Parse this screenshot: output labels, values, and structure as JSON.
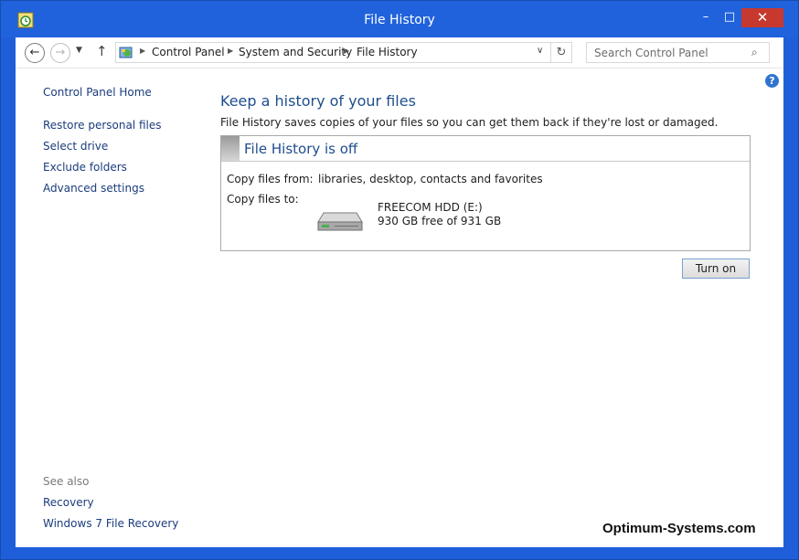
{
  "window": {
    "title": "File History"
  },
  "window_controls": {
    "minimize": "–",
    "maximize": "□",
    "close": "✕"
  },
  "navigation": {
    "back": "←",
    "forward": "→",
    "recent": "▼",
    "up": "↑",
    "breadcrumbs": [
      "Control Panel",
      "System and Security",
      "File History"
    ],
    "refresh": "↻",
    "search_placeholder": "Search Control Panel",
    "search_glyph": "⌕"
  },
  "help": "?",
  "sidebar": {
    "home": "Control Panel Home",
    "items": [
      "Restore personal files",
      "Select drive",
      "Exclude folders",
      "Advanced settings"
    ],
    "see_also_label": "See also",
    "see_also": [
      "Recovery",
      "Windows 7 File Recovery"
    ]
  },
  "main": {
    "heading": "Keep a history of your files",
    "description": "File History saves copies of your files so you can get them back if they're lost or damaged.",
    "status_title": "File History is off",
    "copy_from_label": "Copy files from:",
    "copy_from_value": "libraries, desktop, contacts and favorites",
    "copy_to_label": "Copy files to:",
    "drive_name": "FREECOM HDD (E:)",
    "drive_free": "930 GB free of 931 GB",
    "turn_on_label": "Turn on"
  },
  "watermark": "Optimum-Systems.com",
  "colors": {
    "titlebar": "#1f62dc",
    "close": "#c7392f",
    "link": "#1b3c7d",
    "heading": "#1e4e8c"
  }
}
